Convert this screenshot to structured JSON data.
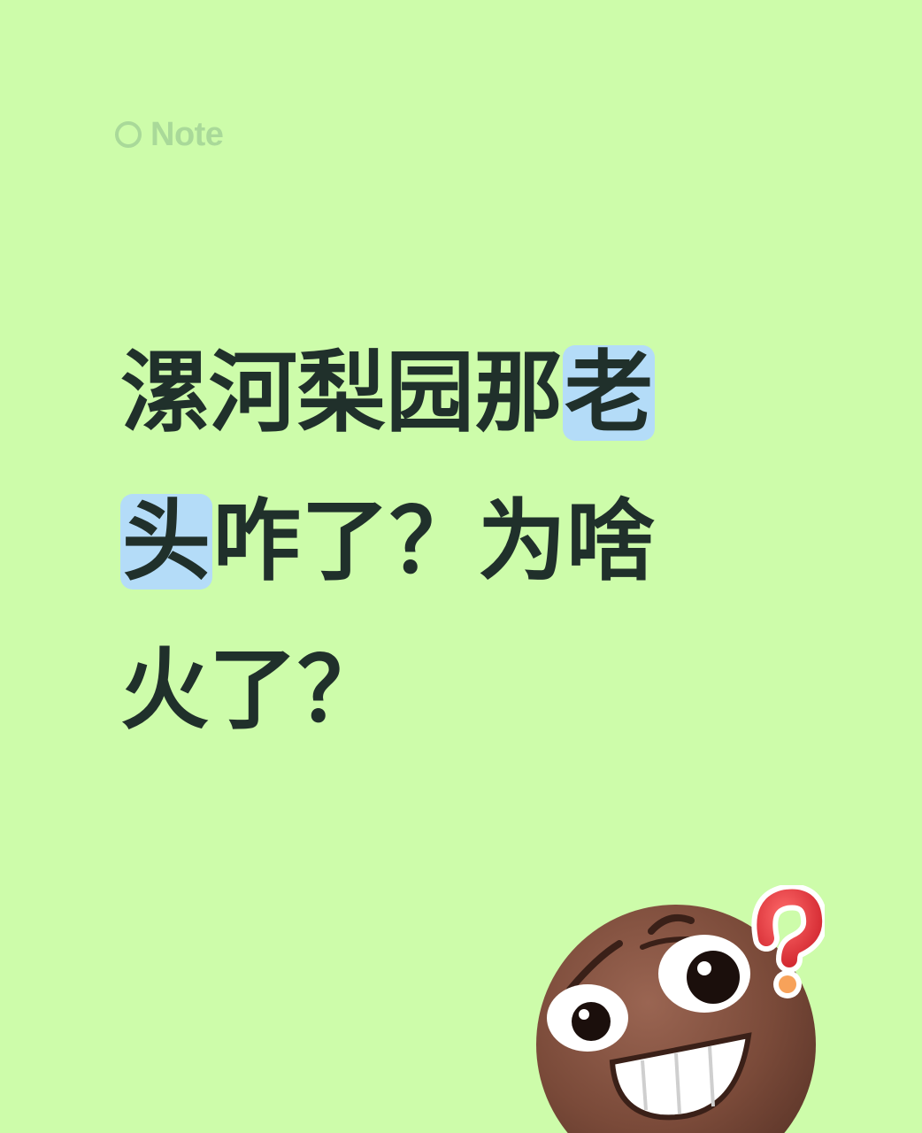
{
  "note": {
    "label": "Note",
    "icon": "circle-icon"
  },
  "headline": {
    "line1_text": "漯河梨园那",
    "line1_highlight": "老",
    "line2_highlight": "头",
    "line2_text": "咋了？为啥",
    "line3_text": "火了？"
  },
  "sticker": {
    "icon": "confused-grinning-face-with-question-mark-icon"
  },
  "colors": {
    "background": "#cdfcaa",
    "text": "#20302b",
    "highlight": "#b4dcf8",
    "note": "#a9d999",
    "question_mark": "#e5343c"
  }
}
